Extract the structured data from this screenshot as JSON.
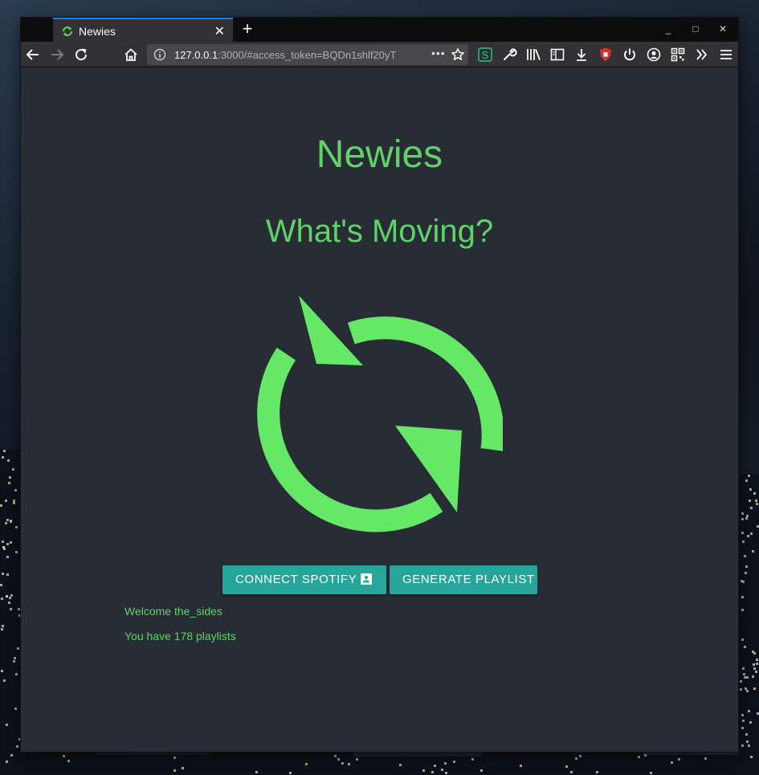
{
  "colors": {
    "accent": "#5fd367",
    "button_bg": "#26a69a",
    "page_bg": "#282c34",
    "tab_highlight": "#0a84ff"
  },
  "browser": {
    "tab": {
      "title": "Newies",
      "favicon": "refresh-icon",
      "close_icon": "close-icon"
    },
    "new_tab_icon": "plus-icon",
    "window_controls": [
      "minimize-icon",
      "maximize-icon",
      "close-window-icon"
    ],
    "nav": {
      "back": "back-arrow-icon",
      "forward": "forward-arrow-icon",
      "reload": "reload-icon",
      "home": "home-icon"
    },
    "url": {
      "host": "127.0.0.1",
      "rest": ":3000/#access_token=BQDn1shlf20yT",
      "page_actions_icon": "ellipsis-icon",
      "bookmark_icon": "star-icon"
    },
    "toolbar_icons": [
      "stylus-icon",
      "wrench-icon",
      "library-icon",
      "sidebar-icon",
      "download-icon",
      "ublock-icon",
      "power-icon",
      "account-icon",
      "qr-code-icon",
      "overflow-chevrons-icon",
      "hamburger-menu-icon"
    ]
  },
  "app": {
    "title": "Newies",
    "subtitle": "What's Moving?",
    "logo_icon": "refresh-arrows-icon",
    "buttons": {
      "connect_label": "CONNECT SPOTIFY",
      "connect_icon": "account-box-icon",
      "generate_label": "GENERATE PLAYLIST"
    },
    "welcome": "Welcome the_sides",
    "playlists": "You have 178 playlists"
  }
}
